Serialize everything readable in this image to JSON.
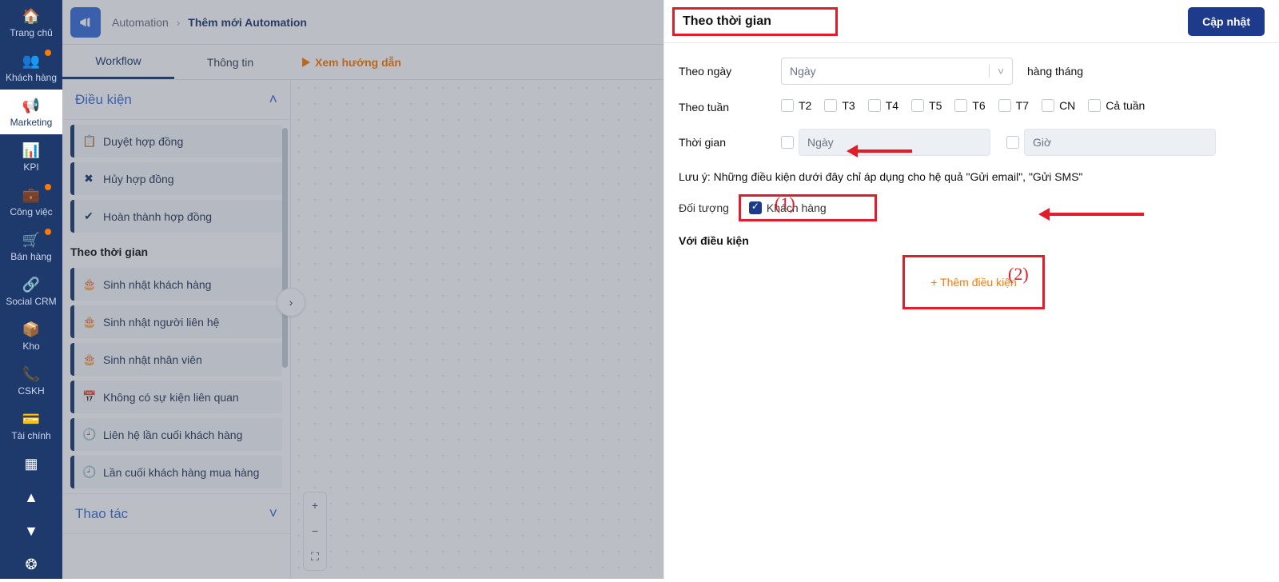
{
  "leftnav": [
    {
      "icon": "home",
      "label": "Trang chủ",
      "active": false,
      "dot": false
    },
    {
      "icon": "users",
      "label": "Khách hàng",
      "active": false,
      "dot": true
    },
    {
      "icon": "bullhorn",
      "label": "Marketing",
      "active": true,
      "dot": false
    },
    {
      "icon": "chart",
      "label": "KPI",
      "active": false,
      "dot": false
    },
    {
      "icon": "briefcase",
      "label": "Công việc",
      "active": false,
      "dot": true
    },
    {
      "icon": "cart",
      "label": "Bán hàng",
      "active": false,
      "dot": true
    },
    {
      "icon": "share",
      "label": "Social CRM",
      "active": false,
      "dot": false
    },
    {
      "icon": "box",
      "label": "Kho",
      "active": false,
      "dot": false
    },
    {
      "icon": "phone",
      "label": "CSKH",
      "active": false,
      "dot": false
    },
    {
      "icon": "wallet",
      "label": "Tài chính",
      "active": false,
      "dot": false
    }
  ],
  "leftnav_extra": {
    "collapse": "▲",
    "expand": "▼",
    "help": "❂",
    "calendar": "▦"
  },
  "breadcrumb": {
    "root": "Automation",
    "sep": "›",
    "current": "Thêm mới Automation"
  },
  "tabs": {
    "workflow": "Workflow",
    "info": "Thông tin"
  },
  "guide_label": "Xem hướng dẫn",
  "cond": {
    "head": "Điều kiện",
    "group_a_items": [
      {
        "ic": "📋",
        "t": "Duyệt hợp đồng"
      },
      {
        "ic": "✖",
        "t": "Hủy hợp đồng"
      },
      {
        "ic": "✔",
        "t": "Hoàn thành hợp đồng"
      }
    ],
    "group_b_title": "Theo thời gian",
    "group_b_items": [
      {
        "ic": "🎂",
        "t": "Sinh nhật khách hàng"
      },
      {
        "ic": "🎂",
        "t": "Sinh nhật người liên hệ"
      },
      {
        "ic": "🎂",
        "t": "Sinh nhật nhân viên"
      },
      {
        "ic": "📅",
        "t": "Không có sự kiện liên quan"
      },
      {
        "ic": "🕘",
        "t": "Liên hệ lần cuối khách hàng"
      },
      {
        "ic": "🕘",
        "t": "Lần cuối khách hàng mua hàng"
      }
    ],
    "head2": "Thao tác"
  },
  "zoom": {
    "plus": "+",
    "minus": "−",
    "fit": "⛶"
  },
  "panel": {
    "title": "Theo thời gian",
    "update": "Cập nhật",
    "by_day_label": "Theo ngày",
    "day_placeholder": "Ngày",
    "monthly": "hàng tháng",
    "by_week_label": "Theo tuần",
    "weekdays": [
      "T2",
      "T3",
      "T4",
      "T5",
      "T6",
      "T7",
      "CN",
      "Cả tuần"
    ],
    "time_label": "Thời gian",
    "time_day_placeholder": "Ngày",
    "time_hour_placeholder": "Giờ",
    "note": "Lưu ý: Những điều kiện dưới đây chỉ áp dụng cho hệ quả \"Gửi email\", \"Gửi SMS\"",
    "obj_label": "Đối tượng",
    "obj_value": "Khách hàng",
    "with_cond": "Với điều kiện",
    "add_cond": "+ Thêm điều kiện"
  },
  "anno": {
    "one": "(1)",
    "two": "(2)"
  }
}
